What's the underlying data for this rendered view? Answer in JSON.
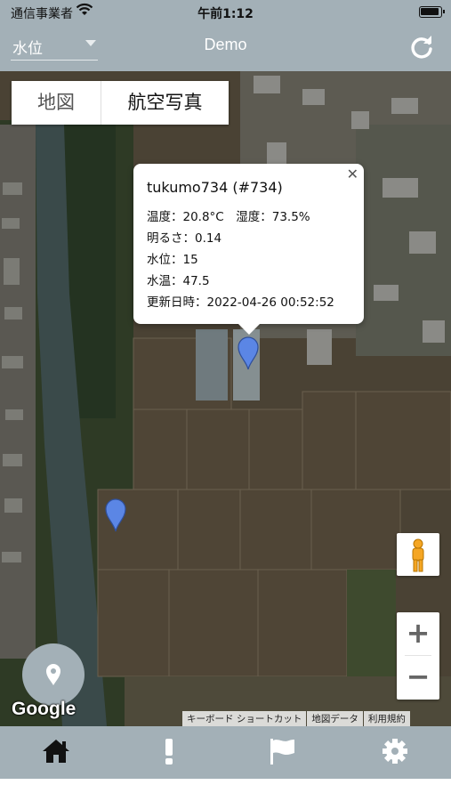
{
  "status_bar": {
    "carrier": "通信事業者",
    "time": "午前1:12"
  },
  "header": {
    "selector_value": "水位",
    "title": "Demo",
    "refresh_icon": "refresh-icon"
  },
  "map": {
    "type_control": {
      "map_label": "地図",
      "satellite_label": "航空写真",
      "selected": "航空写真"
    },
    "info_window": {
      "title": "tukumo734 (#734)",
      "lines": [
        "温度：20.8°C　湿度：73.5%",
        "明るさ：0.14",
        "水位：15",
        "水温：47.5",
        "更新日時：2022-04-26 00:52:52"
      ]
    },
    "markers": [
      {
        "name": "marker-734"
      },
      {
        "name": "marker-2"
      }
    ],
    "google_logo": "Google",
    "attribution": [
      "キーボード ショートカット",
      "地図データ",
      "利用規約"
    ]
  },
  "tabbar": {
    "items": [
      {
        "icon": "home-icon"
      },
      {
        "icon": "exclamation-icon"
      },
      {
        "icon": "flag-icon"
      },
      {
        "icon": "gear-icon"
      }
    ]
  },
  "colors": {
    "chrome": "#a3b0b7",
    "marker": "#5b86e5"
  }
}
